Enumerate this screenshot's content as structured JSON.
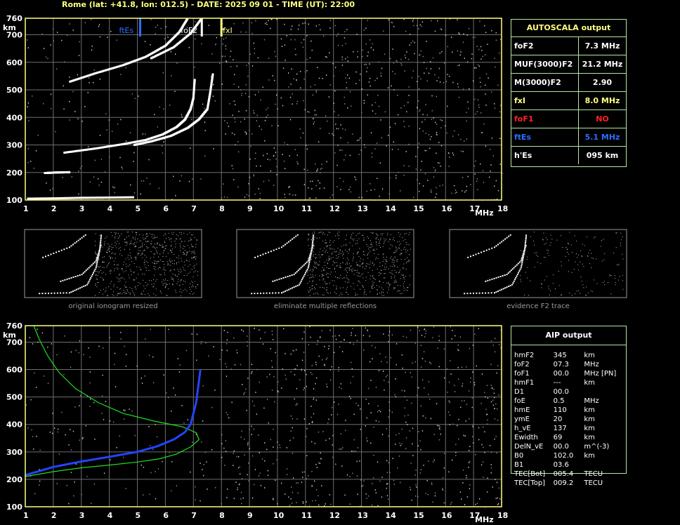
{
  "header": {
    "text": "Rome (lat: +41.8, lon: 012.5) - DATE: 2025 09 01 - TIME (UT): 22:00"
  },
  "colors": {
    "frame": "#ffff80",
    "grid": "#6e6e6e",
    "trace": "#ffffff",
    "profile": "#22dd22",
    "fit": "#2244ff",
    "ftes": "#2b6fff",
    "fxi": "#ffff80",
    "fof2_marker": "#ffffff",
    "panel_border": "#b6e7a0"
  },
  "chart_data": [
    {
      "type": "scatter",
      "name": "main-ionogram",
      "xlabel": "MHz",
      "ylabel": "km",
      "xlim": [
        1,
        18
      ],
      "ylim": [
        100,
        760
      ],
      "x_ticks": [
        "1",
        "2",
        "3",
        "4",
        "5",
        "6",
        "7",
        "8",
        "9",
        "10",
        "11",
        "12",
        "13",
        "14",
        "15",
        "16",
        "17",
        "18"
      ],
      "y_ticks": [
        "100",
        "200",
        "300",
        "400",
        "500",
        "600",
        "700",
        "760"
      ],
      "grid": true,
      "markers": [
        {
          "label": "ftEs",
          "freq": 5.1
        },
        {
          "label": "foF2",
          "freq": 7.3
        },
        {
          "label": "fxI",
          "freq": 8.0
        }
      ],
      "traces": {
        "es": [
          [
            1.1,
            105
          ],
          [
            2,
            106
          ],
          [
            3,
            108
          ],
          [
            4,
            109
          ],
          [
            4.9,
            110
          ]
        ],
        "es2": [
          [
            1.7,
            198
          ],
          [
            2.1,
            200
          ],
          [
            2.6,
            201
          ]
        ],
        "f_o": [
          [
            2.4,
            272
          ],
          [
            3.5,
            287
          ],
          [
            4.5,
            303
          ],
          [
            5.3,
            318
          ],
          [
            5.9,
            338
          ],
          [
            6.4,
            365
          ],
          [
            6.7,
            392
          ],
          [
            6.9,
            430
          ],
          [
            7.0,
            470
          ],
          [
            7.05,
            540
          ]
        ],
        "f_x": [
          [
            4.9,
            300
          ],
          [
            5.5,
            313
          ],
          [
            6.2,
            333
          ],
          [
            6.8,
            362
          ],
          [
            7.2,
            393
          ],
          [
            7.5,
            430
          ],
          [
            7.6,
            490
          ],
          [
            7.7,
            560
          ]
        ],
        "multi_o": [
          [
            2.6,
            530
          ],
          [
            3.5,
            560
          ],
          [
            4.5,
            590
          ],
          [
            5.3,
            620
          ],
          [
            6.0,
            660
          ],
          [
            6.5,
            710
          ],
          [
            6.8,
            760
          ]
        ],
        "multi_x": [
          [
            5.5,
            615
          ],
          [
            6.3,
            655
          ],
          [
            6.9,
            705
          ],
          [
            7.3,
            760
          ]
        ]
      }
    },
    {
      "type": "scatter",
      "name": "aip-ionogram",
      "xlabel": "MHz",
      "ylabel": "km",
      "xlim": [
        1,
        18
      ],
      "ylim": [
        100,
        760
      ],
      "x_ticks": [
        "1",
        "2",
        "3",
        "4",
        "5",
        "6",
        "7",
        "8",
        "9",
        "10",
        "11",
        "12",
        "13",
        "14",
        "15",
        "16",
        "17",
        "18"
      ],
      "y_ticks": [
        "100",
        "200",
        "300",
        "400",
        "500",
        "600",
        "700",
        "760"
      ],
      "grid": true,
      "profile": [
        [
          1.0,
          210
        ],
        [
          2.0,
          228
        ],
        [
          3.0,
          242
        ],
        [
          4.0,
          252
        ],
        [
          5.0,
          263
        ],
        [
          5.8,
          275
        ],
        [
          6.4,
          292
        ],
        [
          6.9,
          318
        ],
        [
          7.2,
          345
        ],
        [
          7.1,
          370
        ],
        [
          6.6,
          392
        ],
        [
          5.6,
          412
        ],
        [
          4.5,
          440
        ],
        [
          3.6,
          480
        ],
        [
          2.8,
          530
        ],
        [
          2.2,
          590
        ],
        [
          1.8,
          650
        ],
        [
          1.5,
          710
        ],
        [
          1.3,
          760
        ]
      ],
      "fit": [
        [
          1.0,
          215
        ],
        [
          2.0,
          245
        ],
        [
          3.0,
          265
        ],
        [
          4.0,
          282
        ],
        [
          5.0,
          300
        ],
        [
          5.7,
          320
        ],
        [
          6.3,
          345
        ],
        [
          6.7,
          372
        ],
        [
          6.9,
          400
        ],
        [
          7.0,
          440
        ],
        [
          7.1,
          480
        ],
        [
          7.25,
          600
        ]
      ]
    }
  ],
  "thumbnails": [
    {
      "title": "original ionogram resized"
    },
    {
      "title": "eliminate multiple reflections"
    },
    {
      "title": "evidence F2 trace"
    }
  ],
  "autoscala": {
    "title": "AUTOSCALA output",
    "rows": [
      {
        "key": "foF2",
        "value": "7.3 MHz",
        "color": "#ffffff"
      },
      {
        "key": "MUF(3000)F2",
        "value": "21.2 MHz",
        "color": "#ffffff"
      },
      {
        "key": "M(3000)F2",
        "value": "2.90",
        "color": "#ffffff"
      },
      {
        "key": "fxI",
        "value": "8.0 MHz",
        "color": "#ffff80"
      },
      {
        "key": "foF1",
        "value": "NO",
        "color": "#ff2222"
      },
      {
        "key": "ftEs",
        "value": "5.1 MHz",
        "color": "#2b6fff"
      },
      {
        "key": "h'Es",
        "value": "095 km",
        "color": "#ffffff"
      }
    ]
  },
  "aip": {
    "title": "AIP output",
    "rows": [
      {
        "key": "hmF2",
        "value": "345",
        "unit": "km"
      },
      {
        "key": "foF2",
        "value": "07.3",
        "unit": "MHz"
      },
      {
        "key": "foF1",
        "value": "00.0",
        "unit": "MHz  [PN]"
      },
      {
        "key": "hmF1",
        "value": "---",
        "unit": "km"
      },
      {
        "key": "D1",
        "value": "00.0",
        "unit": ""
      },
      {
        "key": "foE",
        "value": "0.5",
        "unit": "MHz"
      },
      {
        "key": "hmE",
        "value": "110",
        "unit": "km"
      },
      {
        "key": "ymE",
        "value": "20",
        "unit": "km"
      },
      {
        "key": "h_vE",
        "value": "137",
        "unit": "km"
      },
      {
        "key": "Ewidth",
        "value": "69",
        "unit": "km"
      },
      {
        "key": "DelN_vE",
        "value": "00.0",
        "unit": "m^(-3)"
      },
      {
        "key": "B0",
        "value": "102.0",
        "unit": "km"
      },
      {
        "key": "B1",
        "value": "03.6",
        "unit": ""
      },
      {
        "key": "TEC[Bot]",
        "value": "005.4",
        "unit": "TECU"
      },
      {
        "key": "TEC[Top]",
        "value": "009.2",
        "unit": "TECU"
      }
    ]
  }
}
